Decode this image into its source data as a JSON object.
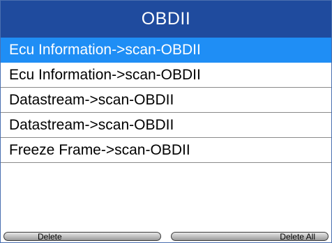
{
  "title": "OBDII",
  "list": {
    "items": [
      {
        "label": "Ecu Information->scan-OBDII",
        "selected": true
      },
      {
        "label": "Ecu Information->scan-OBDII",
        "selected": false
      },
      {
        "label": "Datastream->scan-OBDII",
        "selected": false
      },
      {
        "label": "Datastream->scan-OBDII",
        "selected": false
      },
      {
        "label": "Freeze Frame->scan-OBDII",
        "selected": false
      }
    ]
  },
  "buttons": {
    "delete_label": "Delete",
    "delete_all_label": "Delete All"
  },
  "colors": {
    "title_bar": "#1f4b9e",
    "selected_row": "#1f8ef5"
  }
}
